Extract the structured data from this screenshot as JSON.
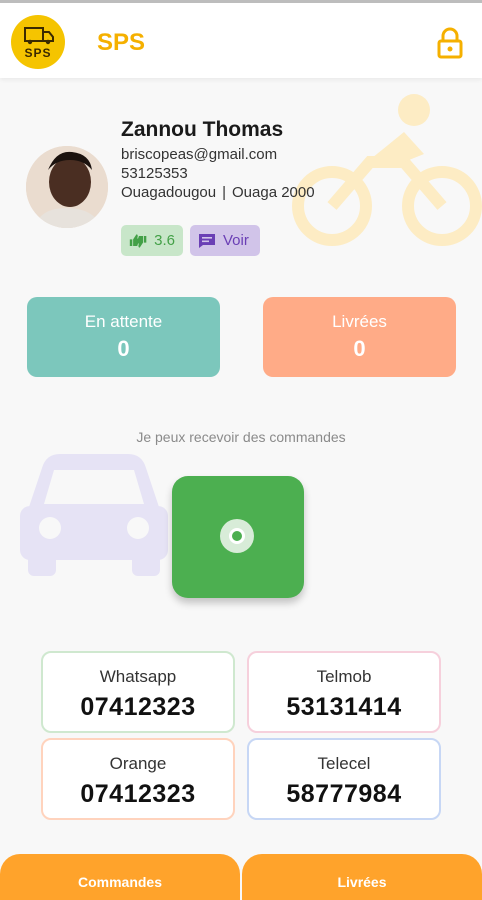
{
  "header": {
    "logo_text": "SPS",
    "title": "SPS",
    "lock_icon": "lock-icon"
  },
  "profile": {
    "name": "Zannou Thomas",
    "email": "briscopeas@gmail.com",
    "phone": "53125353",
    "city": "Ouagadougou",
    "separator": "|",
    "district": "Ouaga 2000",
    "rating": "3.6",
    "view_label": "Voir"
  },
  "stats": {
    "pending_label": "En attente",
    "pending_value": "0",
    "delivered_label": "Livrées",
    "delivered_value": "0"
  },
  "availability": {
    "status_text": "Je peux recevoir des commandes"
  },
  "contacts": [
    {
      "label": "Whatsapp",
      "number": "07412323"
    },
    {
      "label": "Telmob",
      "number": "53131414"
    },
    {
      "label": "Orange",
      "number": "07412323"
    },
    {
      "label": "Telecel",
      "number": "58777984"
    }
  ],
  "bottom_nav": {
    "commandes_label": "Commandes",
    "livrees_label": "Livrées"
  },
  "colors": {
    "brand_yellow": "#f5b000",
    "toggle_green": "#4caf50",
    "pending_teal": "#7cc7bc",
    "delivered_salmon": "#ffab87",
    "nav_orange": "#ffa32b"
  }
}
